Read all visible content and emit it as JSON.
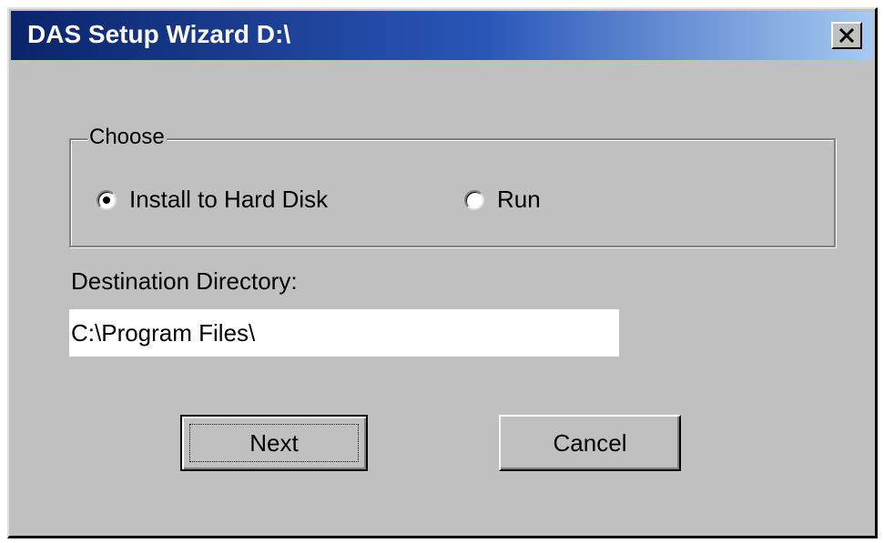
{
  "window": {
    "title": "DAS Setup Wizard D:\\",
    "close_label": "×"
  },
  "group": {
    "legend": "Choose",
    "options": [
      {
        "label": "Install to Hard Disk",
        "selected": true
      },
      {
        "label": "Run",
        "selected": false
      }
    ]
  },
  "destination": {
    "label": "Destination Directory:",
    "value": "C:\\Program Files\\"
  },
  "buttons": {
    "next_label": "Next",
    "cancel_label": "Cancel"
  },
  "colors": {
    "window_bg": "#c0c0c0",
    "titlebar_start": "#0a246a",
    "titlebar_end": "#a6caf0",
    "title_text": "#ffffff"
  }
}
